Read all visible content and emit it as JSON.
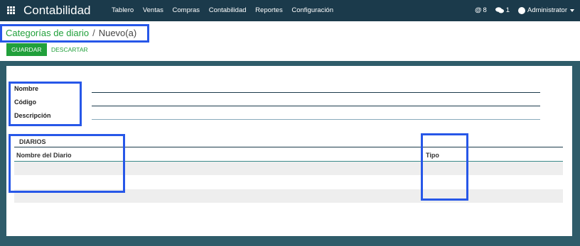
{
  "navbar": {
    "app_title": "Contabilidad",
    "menu": [
      "Tablero",
      "Ventas",
      "Compras",
      "Contabilidad",
      "Reportes",
      "Configuración"
    ],
    "activity_count": "8",
    "message_count": "1",
    "user": "Administrator"
  },
  "breadcrumb": {
    "parent": "Categorías de diario",
    "separator": "/",
    "current": "Nuevo(a)"
  },
  "buttons": {
    "save": "GUARDAR",
    "discard": "DESCARTAR"
  },
  "form": {
    "fields": [
      {
        "label": "Nombre",
        "value": ""
      },
      {
        "label": "Código",
        "value": ""
      },
      {
        "label": "Descripción",
        "value": ""
      }
    ],
    "tab": "DIARIOS",
    "table": {
      "columns": [
        "Nombre del Diario",
        "Tipo"
      ],
      "rows": []
    }
  },
  "colors": {
    "navbar": "#1b3a4b",
    "accent": "#21a03b",
    "annotation": "#2757e8"
  }
}
